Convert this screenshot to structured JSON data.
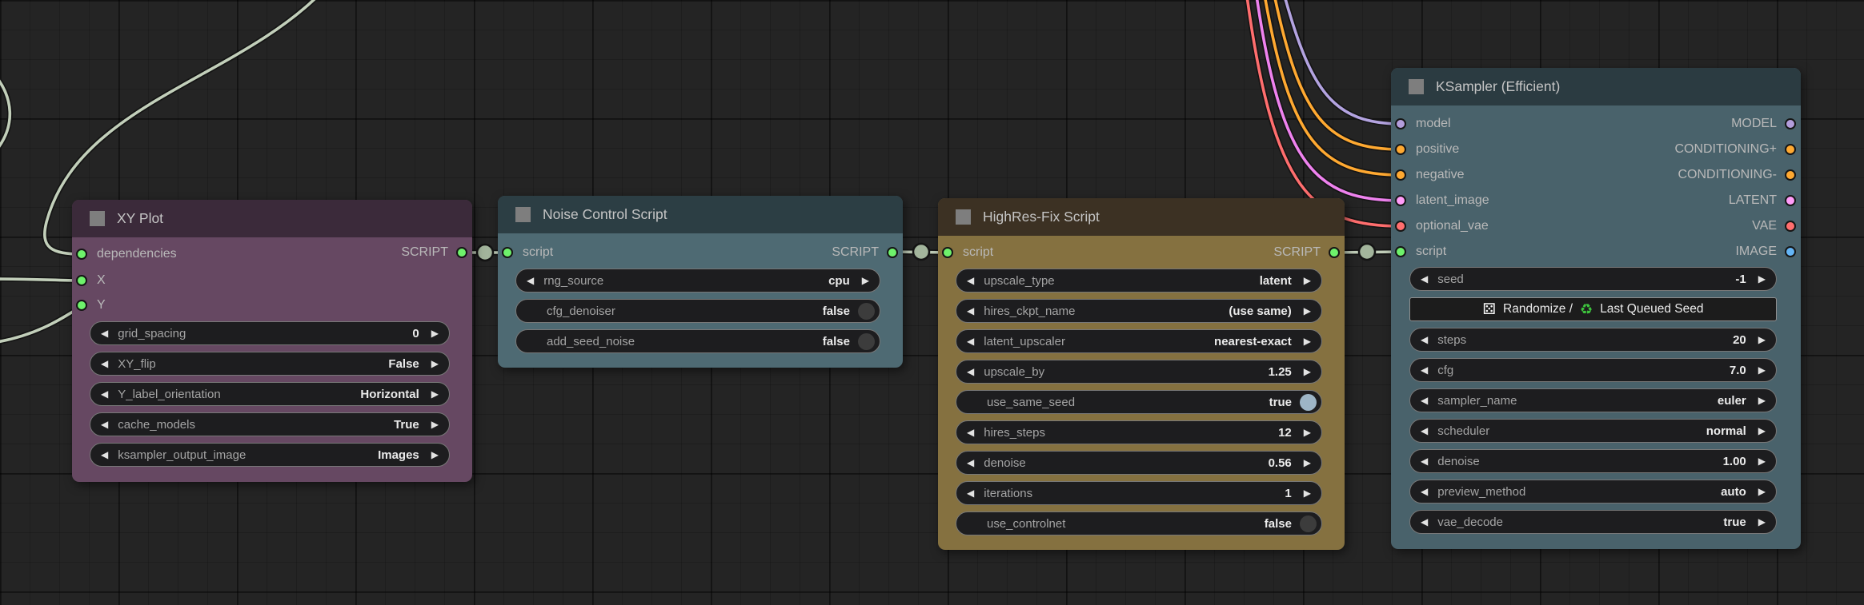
{
  "canvas": {
    "background": "#242424"
  },
  "icons": {
    "arrow_left": "◀",
    "arrow_right": "▶"
  },
  "links": {
    "default_color": "#c2cfba",
    "dot_color": "#a3b59c",
    "colored": [
      {
        "name": "model",
        "color": "#b3a3e0"
      },
      {
        "name": "positive",
        "color": "#ffa931"
      },
      {
        "name": "negative",
        "color": "#ffa931"
      },
      {
        "name": "latent_image",
        "color": "#ee82ee"
      },
      {
        "name": "optional_vae",
        "color": "#ff6e6e"
      }
    ]
  },
  "nodes": [
    {
      "title": "XY Plot",
      "header_color": "#3b2a3a",
      "body_color": "#664862",
      "inputs": [
        {
          "label": "dependencies",
          "color": "#6ef26b"
        },
        {
          "label": "X",
          "color": "#6ef26b"
        },
        {
          "label": "Y",
          "color": "#6ef26b"
        }
      ],
      "outputs": [
        {
          "label": "SCRIPT",
          "color": "#6ef26b"
        }
      ],
      "widgets": [
        {
          "type": "combo",
          "label": "grid_spacing",
          "value": "0"
        },
        {
          "type": "combo",
          "label": "XY_flip",
          "value": "False"
        },
        {
          "type": "combo",
          "label": "Y_label_orientation",
          "value": "Horizontal"
        },
        {
          "type": "combo",
          "label": "cache_models",
          "value": "True"
        },
        {
          "type": "combo",
          "label": "ksampler_output_image",
          "value": "Images"
        }
      ]
    },
    {
      "title": "Noise Control Script",
      "header_color": "#2c3e44",
      "body_color": "#4e6a73",
      "inputs": [
        {
          "label": "script",
          "color": "#6ef26b"
        }
      ],
      "outputs": [
        {
          "label": "SCRIPT",
          "color": "#6ef26b"
        }
      ],
      "widgets": [
        {
          "type": "combo",
          "label": "rng_source",
          "value": "cpu"
        },
        {
          "type": "toggle",
          "label": "cfg_denoiser",
          "value": "false"
        },
        {
          "type": "toggle",
          "label": "add_seed_noise",
          "value": "false"
        }
      ]
    },
    {
      "title": "HighRes-Fix Script",
      "header_color": "#3c3123",
      "body_color": "#857140",
      "inputs": [
        {
          "label": "script",
          "color": "#6ef26b"
        }
      ],
      "outputs": [
        {
          "label": "SCRIPT",
          "color": "#6ef26b"
        }
      ],
      "widgets": [
        {
          "type": "combo",
          "label": "upscale_type",
          "value": "latent"
        },
        {
          "type": "combo",
          "label": "hires_ckpt_name",
          "value": "(use same)"
        },
        {
          "type": "combo",
          "label": "latent_upscaler",
          "value": "nearest-exact"
        },
        {
          "type": "combo",
          "label": "upscale_by",
          "value": "1.25"
        },
        {
          "type": "toggle",
          "label": "use_same_seed",
          "value": "true"
        },
        {
          "type": "combo",
          "label": "hires_steps",
          "value": "12"
        },
        {
          "type": "combo",
          "label": "denoise",
          "value": "0.56"
        },
        {
          "type": "combo",
          "label": "iterations",
          "value": "1"
        },
        {
          "type": "toggle",
          "label": "use_controlnet",
          "value": "false"
        }
      ]
    },
    {
      "title": "KSampler (Efficient)",
      "header_color": "#2b3b41",
      "body_color": "#49626b",
      "inputs": [
        {
          "label": "model",
          "color": "#b39ddb"
        },
        {
          "label": "positive",
          "color": "#ffa931"
        },
        {
          "label": "negative",
          "color": "#ffa931"
        },
        {
          "label": "latent_image",
          "color": "#ff9cf9"
        },
        {
          "label": "optional_vae",
          "color": "#ff6e6e"
        },
        {
          "label": "script",
          "color": "#6ef26b"
        }
      ],
      "outputs": [
        {
          "label": "MODEL",
          "color": "#b39ddb"
        },
        {
          "label": "CONDITIONING+",
          "color": "#ffa931"
        },
        {
          "label": "CONDITIONING-",
          "color": "#ffa931"
        },
        {
          "label": "LATENT",
          "color": "#ff9cf9"
        },
        {
          "label": "VAE",
          "color": "#ff6e6e"
        },
        {
          "label": "IMAGE",
          "color": "#64b5f6"
        }
      ],
      "widgets": [
        {
          "type": "combo",
          "label": "seed",
          "value": "-1"
        },
        {
          "type": "button",
          "dice_icon": "⚄",
          "label_1": "Randomize /",
          "recycle_icon": "♻",
          "label_2": "Last Queued Seed"
        },
        {
          "type": "combo",
          "label": "steps",
          "value": "20"
        },
        {
          "type": "combo",
          "label": "cfg",
          "value": "7.0"
        },
        {
          "type": "combo",
          "label": "sampler_name",
          "value": "euler"
        },
        {
          "type": "combo",
          "label": "scheduler",
          "value": "normal"
        },
        {
          "type": "combo",
          "label": "denoise",
          "value": "1.00"
        },
        {
          "type": "combo",
          "label": "preview_method",
          "value": "auto"
        },
        {
          "type": "combo",
          "label": "vae_decode",
          "value": "true"
        }
      ]
    }
  ]
}
